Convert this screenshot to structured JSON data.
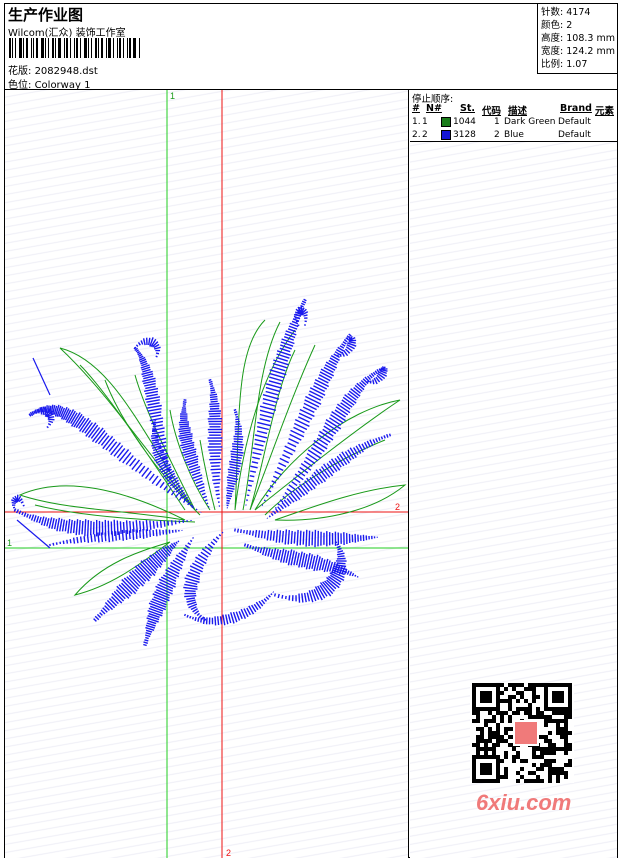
{
  "header": {
    "title": "生产作业图",
    "subtitle": "Wilcom(汇众) 装饰工作室",
    "design_label": "花版:",
    "design_file": "2082948.dst",
    "colorway_label": "色位:",
    "colorway": "Colorway 1"
  },
  "info": {
    "stitches_label": "针数:",
    "stitches": "4174",
    "colors_label": "颜色:",
    "colors": "2",
    "height_label": "高度:",
    "height": "108.3 mm",
    "width_label": "宽度:",
    "width": "124.2 mm",
    "scale_label": "比例:",
    "scale": "1.07"
  },
  "stop_sequence": {
    "title": "停止顺序:",
    "headers": {
      "hash": "#",
      "no": "N#",
      "st": "St.",
      "code": "代码",
      "desc": "描述",
      "brand": "Brand",
      "element": "元素"
    },
    "rows": [
      {
        "idx": "1.",
        "no": "1",
        "color": "#1a7d1a",
        "st": "1044",
        "code": "1",
        "desc": "Dark Green",
        "brand": "Default"
      },
      {
        "idx": "2.",
        "no": "2",
        "color": "#1515d6",
        "st": "3128",
        "code": "2",
        "desc": "Blue",
        "brand": "Default"
      }
    ]
  },
  "axes": {
    "vertical_green_label": "1",
    "horizontal_green_label": "1",
    "horizontal_red_label": "2",
    "vertical_red_label": "2",
    "green_color": "#22cc22",
    "red_color": "#ee1111"
  },
  "colors": {
    "thread_green": "#1a9a1a",
    "thread_blue": "#1a1aee",
    "watermark": "#f07a7a"
  },
  "watermark": {
    "text": "6xiu.com",
    "stamp_text": "汉图印"
  }
}
